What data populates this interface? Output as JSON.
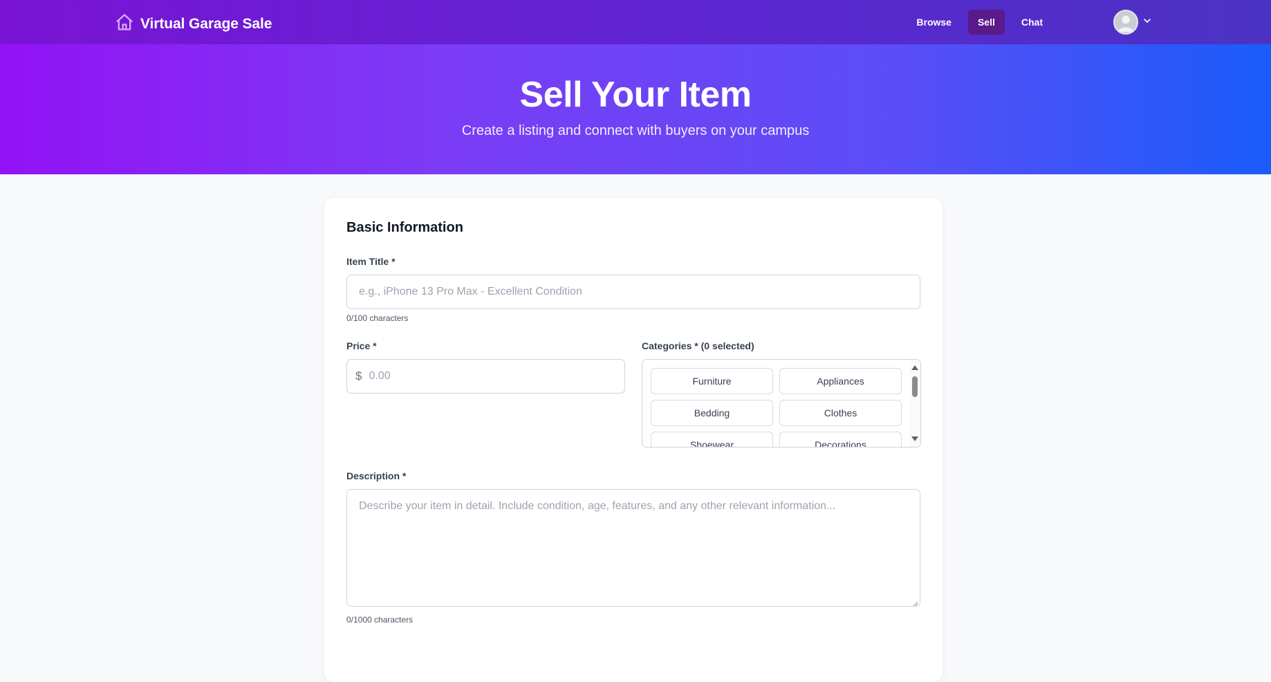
{
  "navbar": {
    "brand_name": "Virtual Garage Sale",
    "links": [
      {
        "label": "Browse",
        "active": false
      },
      {
        "label": "Sell",
        "active": true
      },
      {
        "label": "Chat",
        "active": false
      }
    ]
  },
  "hero": {
    "title": "Sell Your Item",
    "subtitle": "Create a listing and connect with buyers on your campus"
  },
  "form": {
    "section_title": "Basic Information",
    "title_field": {
      "label": "Item Title *",
      "placeholder": "e.g., iPhone 13 Pro Max - Excellent Condition",
      "counter": "0/100 characters"
    },
    "price_field": {
      "label": "Price *",
      "currency_symbol": "$",
      "placeholder": "0.00"
    },
    "categories_field": {
      "label": "Categories * (0 selected)",
      "options": [
        "Furniture",
        "Appliances",
        "Bedding",
        "Clothes",
        "Shoewear",
        "Decorations"
      ]
    },
    "description_field": {
      "label": "Description *",
      "placeholder": "Describe your item in detail. Include condition, age, features, and any other relevant information...",
      "counter": "0/1000 characters"
    }
  },
  "colors": {
    "accent": "#7b3cf5",
    "nav_active": "#5a1a8a",
    "hero_start": "#9312f5",
    "hero_end": "#1a5cfb"
  },
  "icons": {
    "brand": "home-icon",
    "avatar": "user-avatar-icon",
    "dropdown": "chevron-down-icon"
  }
}
